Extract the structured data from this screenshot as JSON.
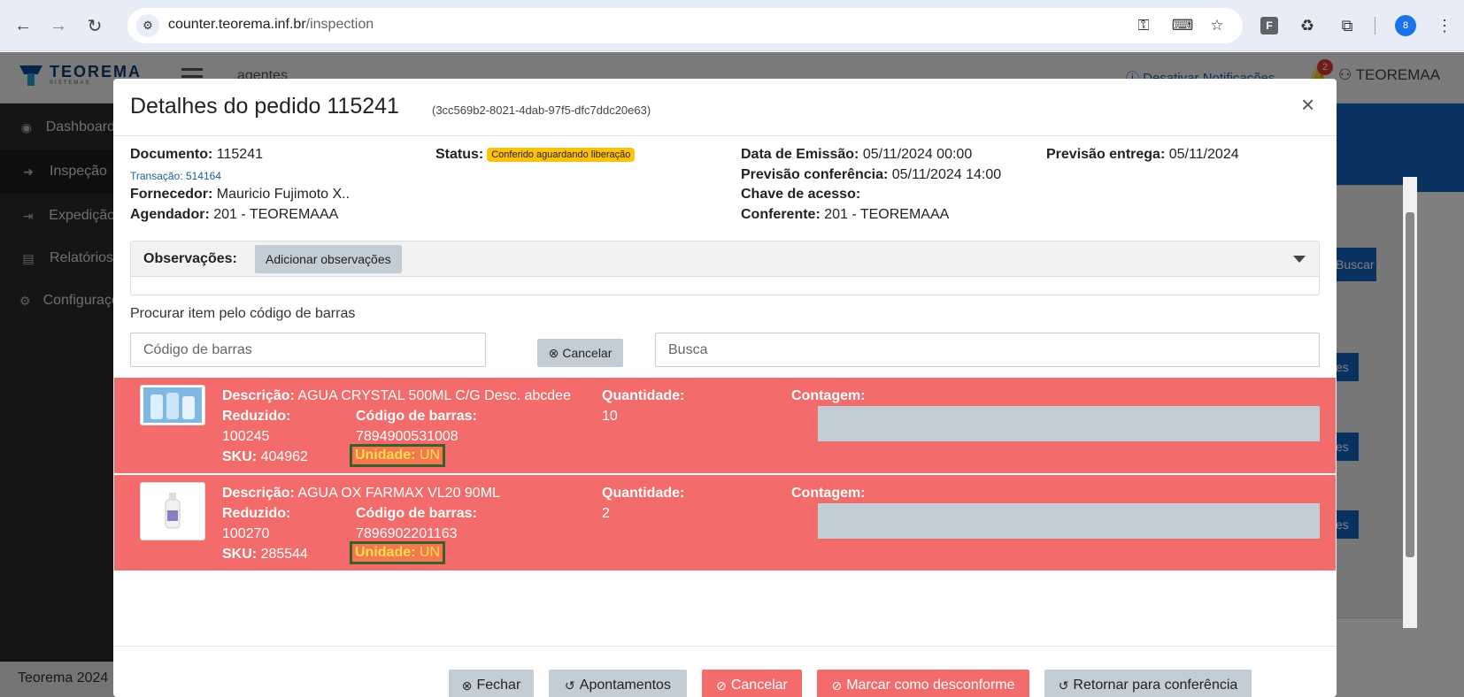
{
  "browser": {
    "url_host": "counter.teorema.inf.br",
    "url_path": "/inspection",
    "profile_initials": "8",
    "ext_f": "F"
  },
  "app": {
    "logo_text": "TEOREMA",
    "logo_sub": "SISTEMAS",
    "header_agents": "agentes",
    "notify_link": "ⓘ Desativar Notificações",
    "notify_count": "2",
    "user": "TEOREMAA",
    "sidebar": [
      {
        "label": "Dashboard"
      },
      {
        "label": "Inspeção"
      },
      {
        "label": "Expedição"
      },
      {
        "label": "Relatórios"
      },
      {
        "label": "Configurações"
      }
    ],
    "footer": "Teorema 2024",
    "bg_button_buscar": "Buscar",
    "bg_button_es": "es"
  },
  "modal": {
    "title": "Detalhes do pedido 115241",
    "uuid": "(3cc569b2-8021-4dab-97f5-dfc7ddc20e63)",
    "documento_label": "Documento:",
    "documento": "115241",
    "transacao_label": "Transação:",
    "transacao": "514164",
    "fornecedor_label": "Fornecedor:",
    "fornecedor": "Mauricio Fujimoto X..",
    "agendador_label": "Agendador:",
    "agendador": "201 - TEOREMAAA",
    "status_label": "Status:",
    "status": "Conferido aguardando liberação",
    "emissao_label": "Data de Emissão:",
    "emissao": "05/11/2024 00:00",
    "prev_conf_label": "Previsão conferência:",
    "prev_conf": "05/11/2024 14:00",
    "chave_label": "Chave de acesso:",
    "conferente_label": "Conferente:",
    "conferente": "201 - TEOREMAAA",
    "prev_entrega_label": "Previsão entrega:",
    "prev_entrega": "05/11/2024",
    "obs_label": "Observações:",
    "obs_add": "Adicionar observações",
    "search_label": "Procurar item pelo código de barras",
    "barcode_placeholder": "Código de barras",
    "cancel_small": "Cancelar",
    "busca_placeholder": "Busca",
    "labels": {
      "descricao": "Descrição:",
      "reduzido": "Reduzido:",
      "codigo": "Código de barras:",
      "sku": "SKU:",
      "unidade": "Unidade:",
      "quantidade": "Quantidade:",
      "contagem": "Contagem:"
    },
    "items": [
      {
        "descricao": "AGUA CRYSTAL 500ML C/G Desc. abcdee",
        "reduzido": "100245",
        "codigo": "7894900531008",
        "sku": "404962",
        "unidade": "UN",
        "quantidade": "10"
      },
      {
        "descricao": "AGUA OX FARMAX VL20 90ML",
        "reduzido": "100270",
        "codigo": "7896902201163",
        "sku": "285544",
        "unidade": "UN",
        "quantidade": "2"
      }
    ],
    "footer_buttons": {
      "fechar": "Fechar",
      "apontamentos": "Apontamentos",
      "cancelar": "Cancelar",
      "desconforme": "Marcar como desconforme",
      "retornar": "Retornar para conferência"
    }
  },
  "colors": {
    "row_error": "#f46b6b",
    "status_badge": "#ffc107",
    "accent_blue": "#1565c0"
  }
}
